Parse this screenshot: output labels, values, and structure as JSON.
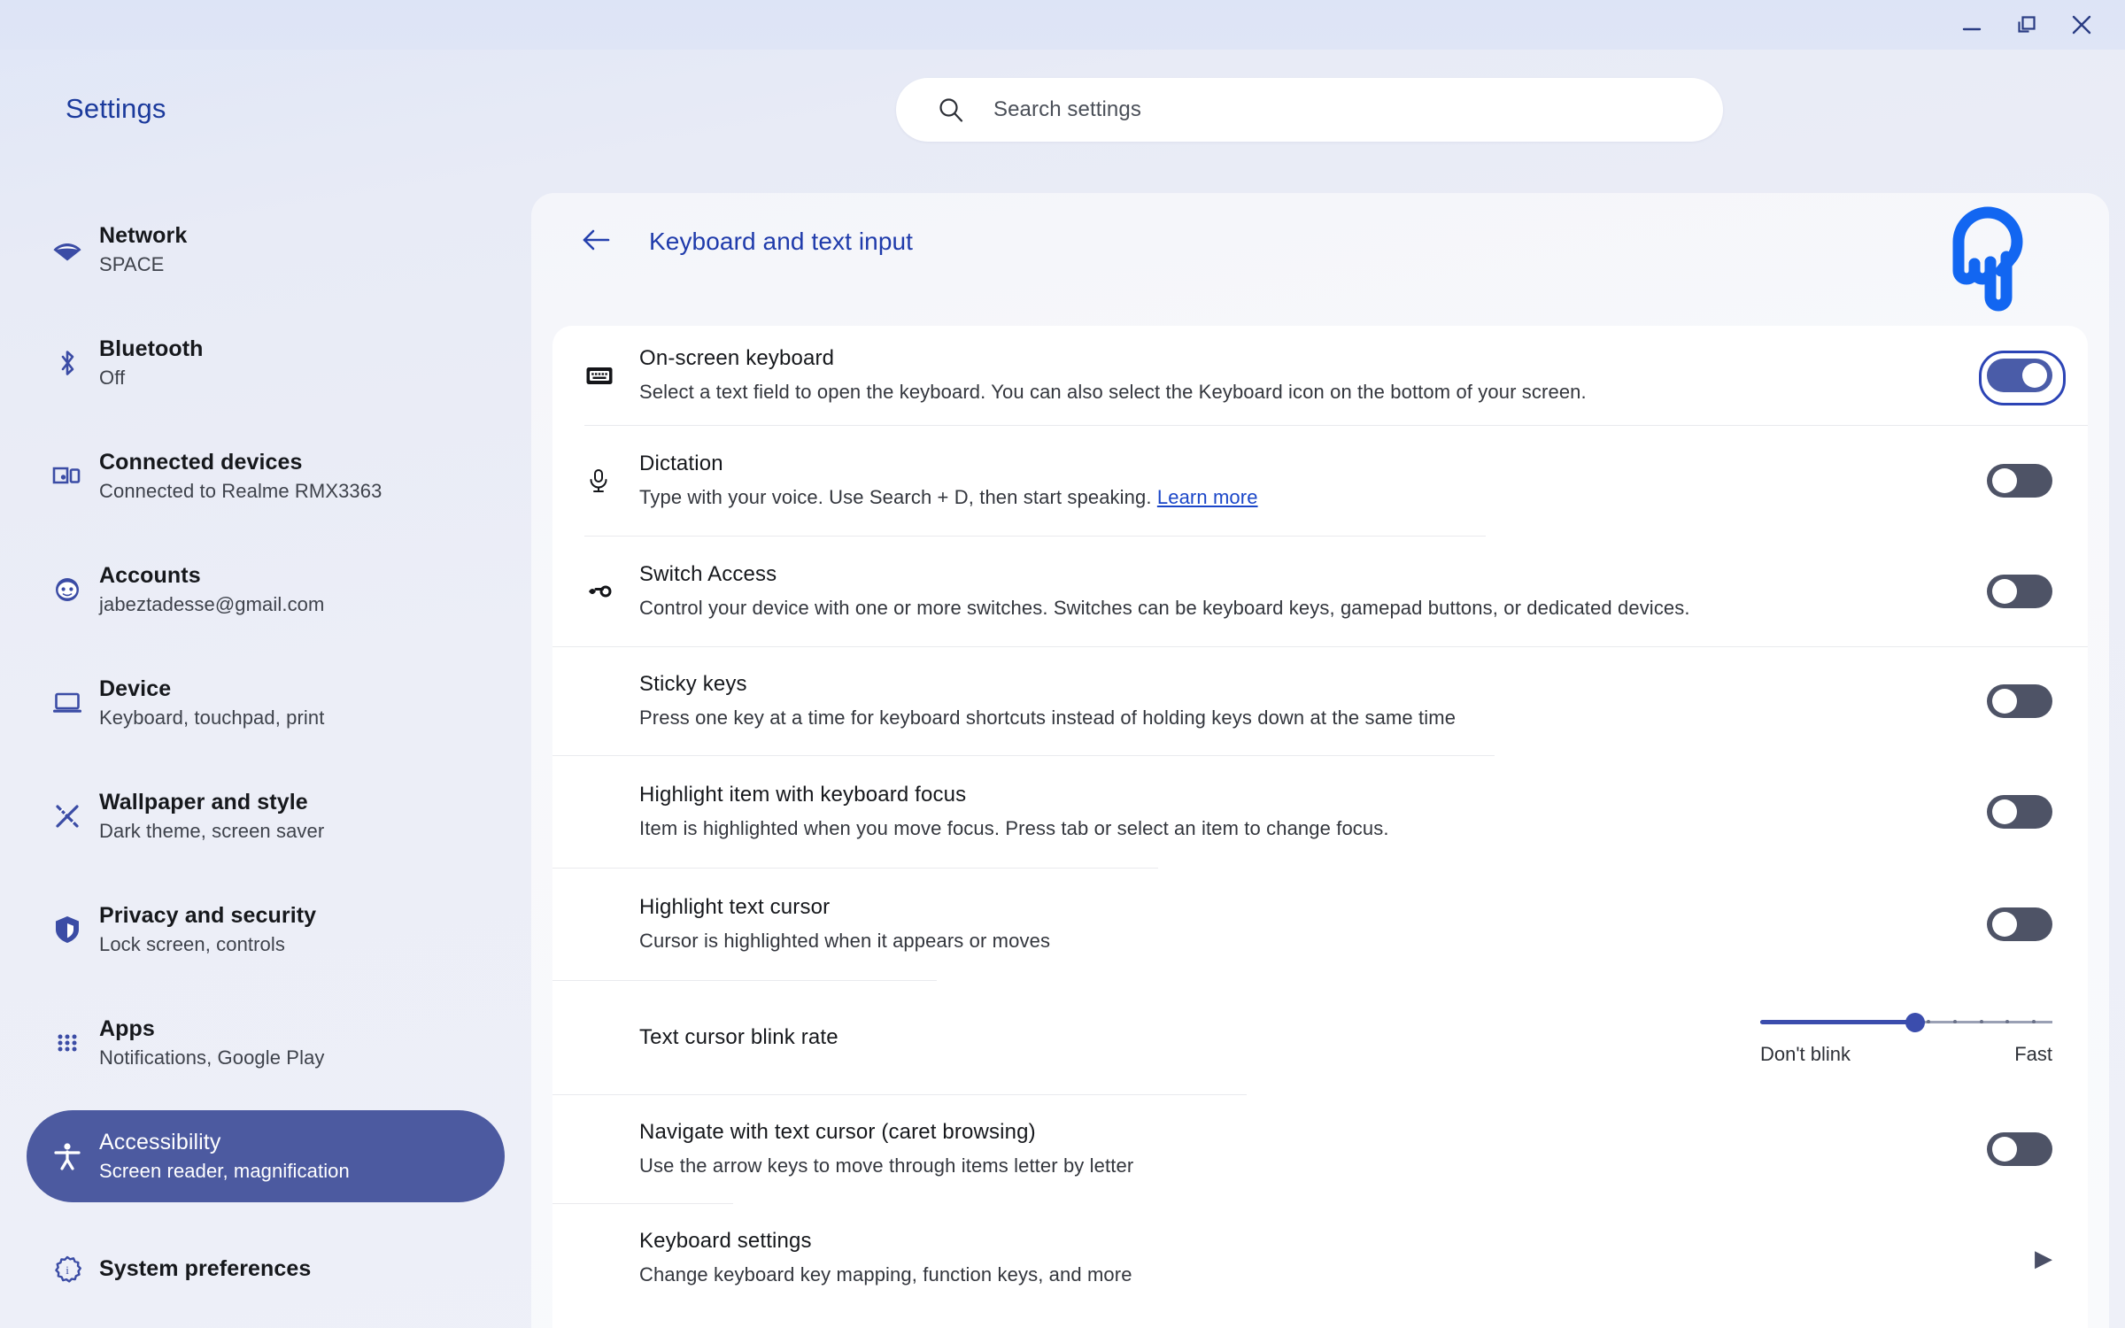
{
  "window": {
    "minimize_label": "Minimize",
    "restore_label": "Restore",
    "close_label": "Close"
  },
  "header": {
    "app_title": "Settings",
    "accent_color": "#1b3a9c"
  },
  "search": {
    "placeholder": "Search settings",
    "value": "",
    "icon": "search-icon"
  },
  "sidebar": {
    "items": [
      {
        "icon": "wifi-icon",
        "label": "Network",
        "sub": "SPACE",
        "selected": false
      },
      {
        "icon": "bluetooth-icon",
        "label": "Bluetooth",
        "sub": "Off",
        "selected": false
      },
      {
        "icon": "connected-devices-icon",
        "label": "Connected devices",
        "sub": "Connected to Realme RMX3363",
        "selected": false
      },
      {
        "icon": "account-icon",
        "label": "Accounts",
        "sub": "jabeztadesse@gmail.com",
        "selected": false
      },
      {
        "icon": "laptop-icon",
        "label": "Device",
        "sub": "Keyboard, touchpad, print",
        "selected": false
      },
      {
        "icon": "wallpaper-style-icon",
        "label": "Wallpaper and style",
        "sub": "Dark theme, screen saver",
        "selected": false
      },
      {
        "icon": "shield-icon",
        "label": "Privacy and security",
        "sub": "Lock screen, controls",
        "selected": false
      },
      {
        "icon": "apps-grid-icon",
        "label": "Apps",
        "sub": "Notifications, Google Play",
        "selected": false
      },
      {
        "icon": "accessibility-icon",
        "label": "Accessibility",
        "sub": "Screen reader, magnification",
        "selected": true
      },
      {
        "icon": "gear-info-icon",
        "label": "System preferences",
        "sub": "",
        "selected": false
      }
    ],
    "selected_bg": "#4c5aa0"
  },
  "page": {
    "back_icon": "back-arrow-icon",
    "title": "Keyboard and text input",
    "title_color": "#1f3bab"
  },
  "settings_rows": [
    {
      "icon": "keyboard-icon",
      "title": "On-screen keyboard",
      "sub": "Select a text field to open the keyboard. You can also select the Keyboard icon on the bottom of your screen.",
      "control": "toggle",
      "toggle_on": true,
      "focused": true
    },
    {
      "icon": "microphone-icon",
      "title": "Dictation",
      "sub": "Type with your voice. Use Search + D, then start speaking. ",
      "link_text": "Learn more",
      "control": "toggle",
      "toggle_on": false,
      "focused": false
    },
    {
      "icon": "switch-access-icon",
      "title": "Switch Access",
      "sub": "Control your device with one or more switches. Switches can be keyboard keys, gamepad buttons, or dedicated devices.",
      "control": "toggle",
      "toggle_on": false,
      "focused": false
    },
    {
      "icon": "",
      "title": "Sticky keys",
      "sub": "Press one key at a time for keyboard shortcuts instead of holding keys down at the same time",
      "control": "toggle",
      "toggle_on": false,
      "focused": false
    },
    {
      "icon": "",
      "title": "Highlight item with keyboard focus",
      "sub": "Item is highlighted when you move focus. Press tab or select an item to change focus.",
      "control": "toggle",
      "toggle_on": false,
      "focused": false
    },
    {
      "icon": "",
      "title": "Highlight text cursor",
      "sub": "Cursor is highlighted when it appears or moves",
      "control": "toggle",
      "toggle_on": false,
      "focused": false
    },
    {
      "icon": "",
      "title": "Text cursor blink rate",
      "sub": "",
      "control": "slider",
      "slider": {
        "value_percent": 53,
        "min_label": "Don't blink",
        "max_label": "Fast",
        "ticks": 10,
        "fill_color": "#3b4dad"
      }
    },
    {
      "icon": "",
      "title": "Navigate with text cursor (caret browsing)",
      "sub": "Use the arrow keys to move through items letter by letter",
      "control": "toggle",
      "toggle_on": false,
      "focused": false
    },
    {
      "icon": "",
      "title": "Keyboard settings",
      "sub": "Change keyboard key mapping, function keys, and more",
      "control": "chevron",
      "chevron_glyph": "▶"
    }
  ],
  "overlay": {
    "cursor_icon": "pointing-hand-cursor",
    "cursor_color": "#1266f1"
  }
}
